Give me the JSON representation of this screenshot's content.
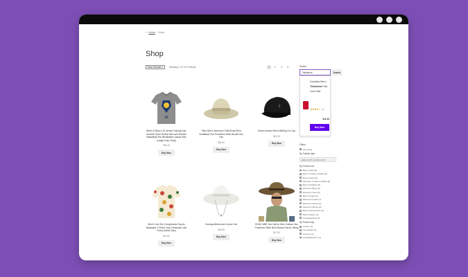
{
  "breadcrumb": {
    "home": "Home",
    "sep": "/",
    "current": "Shop"
  },
  "page_title": "Shop",
  "sorting": {
    "selected": "Most relevant"
  },
  "result_count": "Showing 1–24 of 73 results",
  "pagination": [
    "1",
    "2",
    "3",
    "4"
  ],
  "products": [
    {
      "name": "Men's 5 Slam # 15 Jersey Training Suit, Summer Short Sleeve Men and Women Basketball Tee Breathable Casual Shirt (Large,Color-Gray)",
      "price": "$35.10",
      "button": "Buy Now"
    },
    {
      "name": "Tilley Men's Womens LTM6 Broad Brim Ventilation Sun Protection Airflo Bucket Sun Hat",
      "price": "$96.00",
      "button": "Buy Now"
    },
    {
      "name": "Under Armour Men's Blitzing 3.0 Cap",
      "price": "$18.19",
      "button": "Buy Now"
    },
    {
      "name": "Men's Cool Dry Compression Sports Baselayer T-Shirts Tops Christmas Cute Funny Santa Claus",
      "price": "$16.00",
      "button": "Buy Now"
    },
    {
      "name": "Sunday Afternoons Cruiser Hat",
      "price": "$39.99",
      "button": "Buy Now"
    },
    {
      "name": "SOM CUBE Sun Hat for Men Outdoor Sun Protection Wide Brim Bucket Hat for Hiking",
      "price": "$17.99",
      "button": "Buy Now"
    }
  ],
  "search": {
    "label": "Search",
    "value": "Thinkstone",
    "button": "Search"
  },
  "suggestion": {
    "name_part1": "Columbia Men's",
    "name_bold": "Thinkstone",
    "name_part2": "Park Crew Shirt",
    "stars": "★★★★☆",
    "reviews": "(3)",
    "price": "$11.53",
    "button": "Buy Now"
  },
  "filters": {
    "header": "Filters",
    "all_results": "All results",
    "publish_date_label": "By Publish date",
    "publish_date_value": "2022-11-07 to 2022-11-07",
    "category_label": "By Product cat",
    "categories": [
      "Men's Hats (8)",
      "Men's T-shirts & Shirts (8)",
      "Men's Vests (5)",
      "Womens T-shirts & Shirts (6)",
      "Men's Hoodies (5)",
      "Women's Bras (3)",
      "Women's Tees (4)",
      "Men's Coats (4)",
      "Women's Coats (7)",
      "Women's Pants (4)",
      "Women's Shoes (2)",
      "Men's Accessories (4)",
      "Men's Shoes (1)",
      "Uncategorized (1)"
    ],
    "tag_label": "By Product tag",
    "tags": [
      "women (1)",
      "menswhite (1)",
      "womens (1)",
      "hoodiewomen's (1)"
    ]
  },
  "colors": {
    "background": "#7d4fb6",
    "accent": "#6200ee",
    "button_gray": "#eeeeee"
  }
}
